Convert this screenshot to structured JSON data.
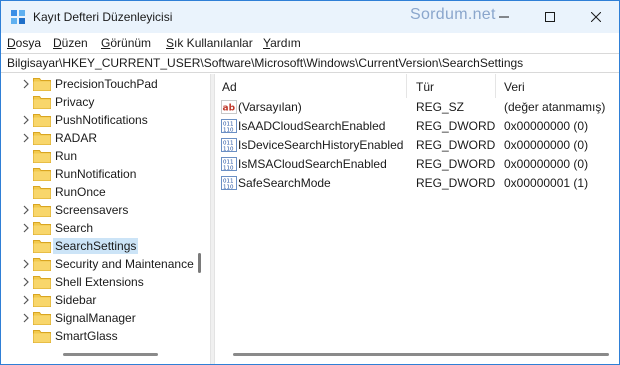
{
  "window": {
    "title": "Kayıt Defteri Düzenleyicisi",
    "watermark": "Sordum.net"
  },
  "menu": {
    "items": [
      {
        "label": "Dosya"
      },
      {
        "label": "Düzen"
      },
      {
        "label": "Görünüm"
      },
      {
        "label": "Sık Kullanılanlar"
      },
      {
        "label": "Yardım"
      }
    ]
  },
  "address": {
    "path": "Bilgisayar\\HKEY_CURRENT_USER\\Software\\Microsoft\\Windows\\CurrentVersion\\SearchSettings"
  },
  "tree": {
    "items": [
      {
        "label": "PrecisionTouchPad",
        "expandable": true,
        "selected": false
      },
      {
        "label": "Privacy",
        "expandable": false,
        "selected": false
      },
      {
        "label": "PushNotifications",
        "expandable": true,
        "selected": false
      },
      {
        "label": "RADAR",
        "expandable": true,
        "selected": false
      },
      {
        "label": "Run",
        "expandable": false,
        "selected": false
      },
      {
        "label": "RunNotification",
        "expandable": false,
        "selected": false
      },
      {
        "label": "RunOnce",
        "expandable": false,
        "selected": false
      },
      {
        "label": "Screensavers",
        "expandable": true,
        "selected": false
      },
      {
        "label": "Search",
        "expandable": true,
        "selected": false
      },
      {
        "label": "SearchSettings",
        "expandable": false,
        "selected": true
      },
      {
        "label": "Security and Maintenance",
        "expandable": true,
        "selected": false
      },
      {
        "label": "Shell Extensions",
        "expandable": true,
        "selected": false
      },
      {
        "label": "Sidebar",
        "expandable": true,
        "selected": false
      },
      {
        "label": "SignalManager",
        "expandable": true,
        "selected": false
      },
      {
        "label": "SmartGlass",
        "expandable": false,
        "selected": false
      }
    ]
  },
  "values": {
    "columns": {
      "name": "Ad",
      "type": "Tür",
      "data": "Veri"
    },
    "rows": [
      {
        "name": "(Varsayılan)",
        "type": "REG_SZ",
        "data": "(değer atanmamış)",
        "icon": "string-value-icon"
      },
      {
        "name": "IsAADCloudSearchEnabled",
        "type": "REG_DWORD",
        "data": "0x00000000 (0)",
        "icon": "binary-value-icon"
      },
      {
        "name": "IsDeviceSearchHistoryEnabled",
        "type": "REG_DWORD",
        "data": "0x00000000 (0)",
        "icon": "binary-value-icon"
      },
      {
        "name": "IsMSACloudSearchEnabled",
        "type": "REG_DWORD",
        "data": "0x00000000 (0)",
        "icon": "binary-value-icon"
      },
      {
        "name": "SafeSearchMode",
        "type": "REG_DWORD",
        "data": "0x00000001 (1)",
        "icon": "binary-value-icon"
      }
    ]
  },
  "colors": {
    "titlebar": "#eaf3fc",
    "selection": "#cce4f7",
    "folder": "#f2c94c",
    "accent_border": "#2f7fd6"
  }
}
